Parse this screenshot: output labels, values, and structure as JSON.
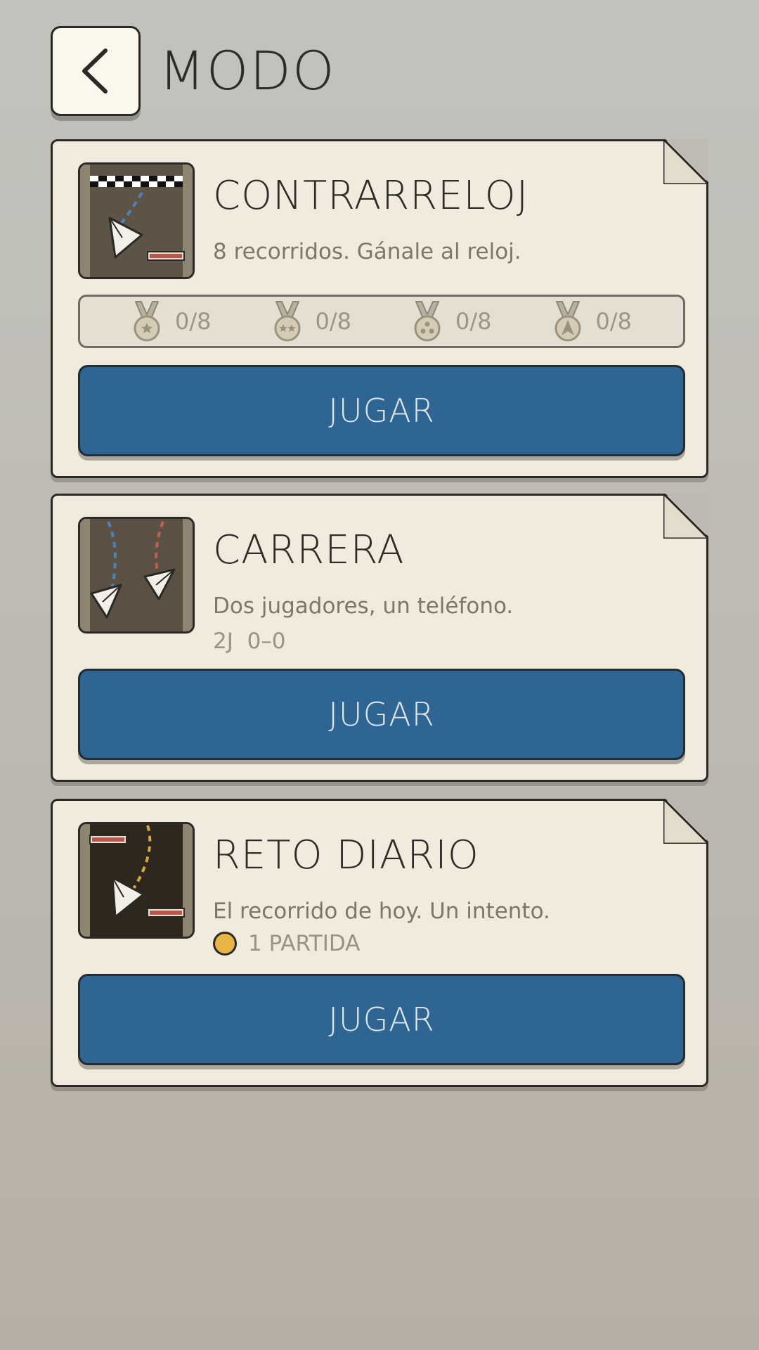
{
  "header": {
    "title": "MODO",
    "back_icon": "chevron-left-icon"
  },
  "modes": [
    {
      "title": "CONTRARRELOJ",
      "description": "8 recorridos. Gánale al reloj.",
      "medals": [
        {
          "icon": "medal-one-star-icon",
          "count": "0/8"
        },
        {
          "icon": "medal-two-star-icon",
          "count": "0/8"
        },
        {
          "icon": "medal-three-star-icon",
          "count": "0/8"
        },
        {
          "icon": "medal-plane-icon",
          "count": "0/8"
        }
      ],
      "play_label": "JUGAR"
    },
    {
      "title": "CARRERA",
      "description": "Dos jugadores, un teléfono.",
      "extra": "2J  0–0",
      "play_label": "JUGAR"
    },
    {
      "title": "RETO DIARIO",
      "description": "El recorrido de hoy. Un intento.",
      "extra": "1 PARTIDA",
      "extra_icon": "coin-icon",
      "play_label": "JUGAR"
    }
  ],
  "colors": {
    "card_bg": "#f1ebdd",
    "button_blue": "#2f6593",
    "coin_gold": "#e6b546"
  }
}
